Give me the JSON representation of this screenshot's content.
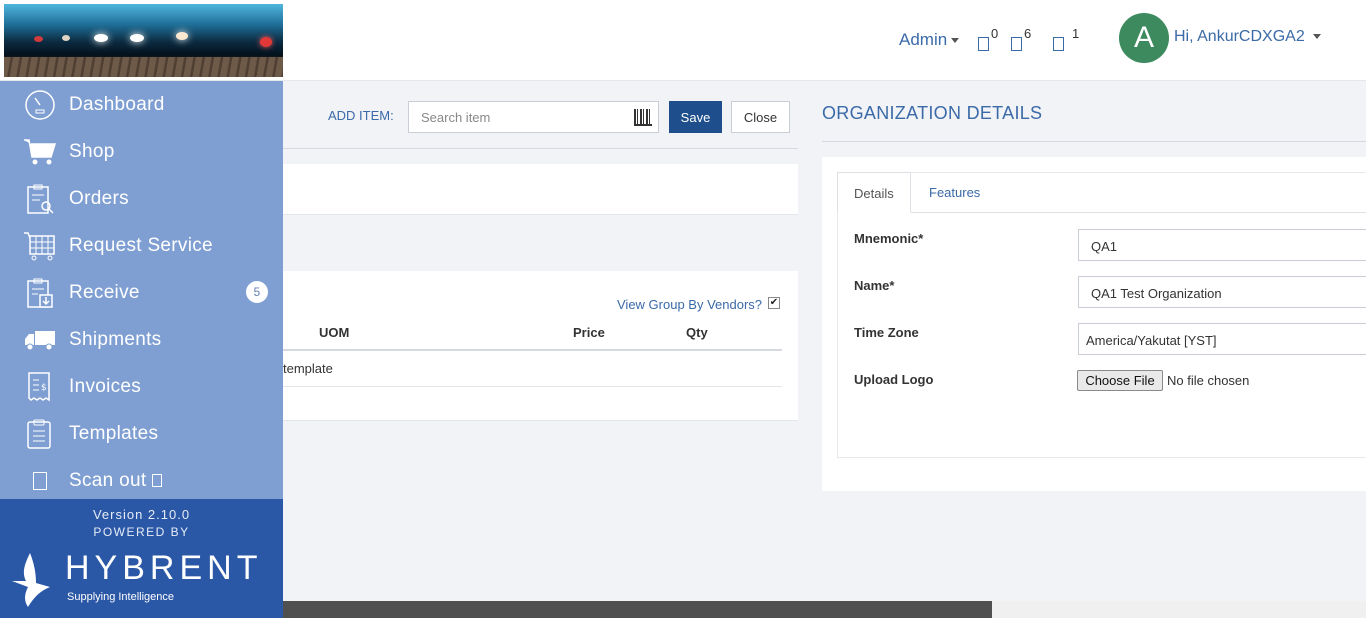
{
  "header": {
    "admin_label": "Admin",
    "icons": [
      {
        "name": "notifications-icon",
        "count": "0"
      },
      {
        "name": "messages-icon",
        "count": "6"
      },
      {
        "name": "tasks-icon",
        "count": "1"
      }
    ],
    "avatar_initial": "A",
    "greeting": "Hi, AnkurCDXGA2"
  },
  "sidebar": {
    "items": [
      {
        "label": "Dashboard",
        "icon": "dashboard-icon"
      },
      {
        "label": "Shop",
        "icon": "cart-icon"
      },
      {
        "label": "Orders",
        "icon": "orders-icon"
      },
      {
        "label": "Request Service",
        "icon": "service-cart-icon"
      },
      {
        "label": "Receive",
        "icon": "receive-icon",
        "badge": "5"
      },
      {
        "label": "Shipments",
        "icon": "truck-icon"
      },
      {
        "label": "Invoices",
        "icon": "invoice-icon"
      },
      {
        "label": "Templates",
        "icon": "templates-icon"
      },
      {
        "label": "Scan out",
        "icon": "scan-icon"
      }
    ],
    "version": "Version 2.10.0",
    "powered_by": "POWERED BY",
    "logo_word": "HYBRENT",
    "logo_tagline": "Supplying Intelligence"
  },
  "cart": {
    "add_item_label": "ADD ITEM:",
    "search_placeholder": "Search item",
    "save_label": "Save",
    "close_label": "Close",
    "group_by_label": "View Group By Vendors?",
    "group_by_checked": true,
    "columns": [
      "UOM",
      "Price",
      "Qty"
    ],
    "row_text": "template"
  },
  "org": {
    "title": "ORGANIZATION DETAILS",
    "tabs": [
      "Details",
      "Features"
    ],
    "fields": [
      {
        "label": "Mnemonic*",
        "value": "QA1"
      },
      {
        "label": "Name*",
        "value": "QA1 Test Organization"
      },
      {
        "label": "Time Zone",
        "value": "America/Yakutat [YST]"
      }
    ],
    "upload_label": "Upload Logo",
    "choose_file": "Choose File",
    "no_file": "No file chosen"
  },
  "colors": {
    "sidebar": "#7f9fd2",
    "sidebar_footer": "#2b58a6",
    "accent": "#3b6aa8",
    "save_button": "#1e4f8c",
    "avatar": "#3d8a5e"
  }
}
